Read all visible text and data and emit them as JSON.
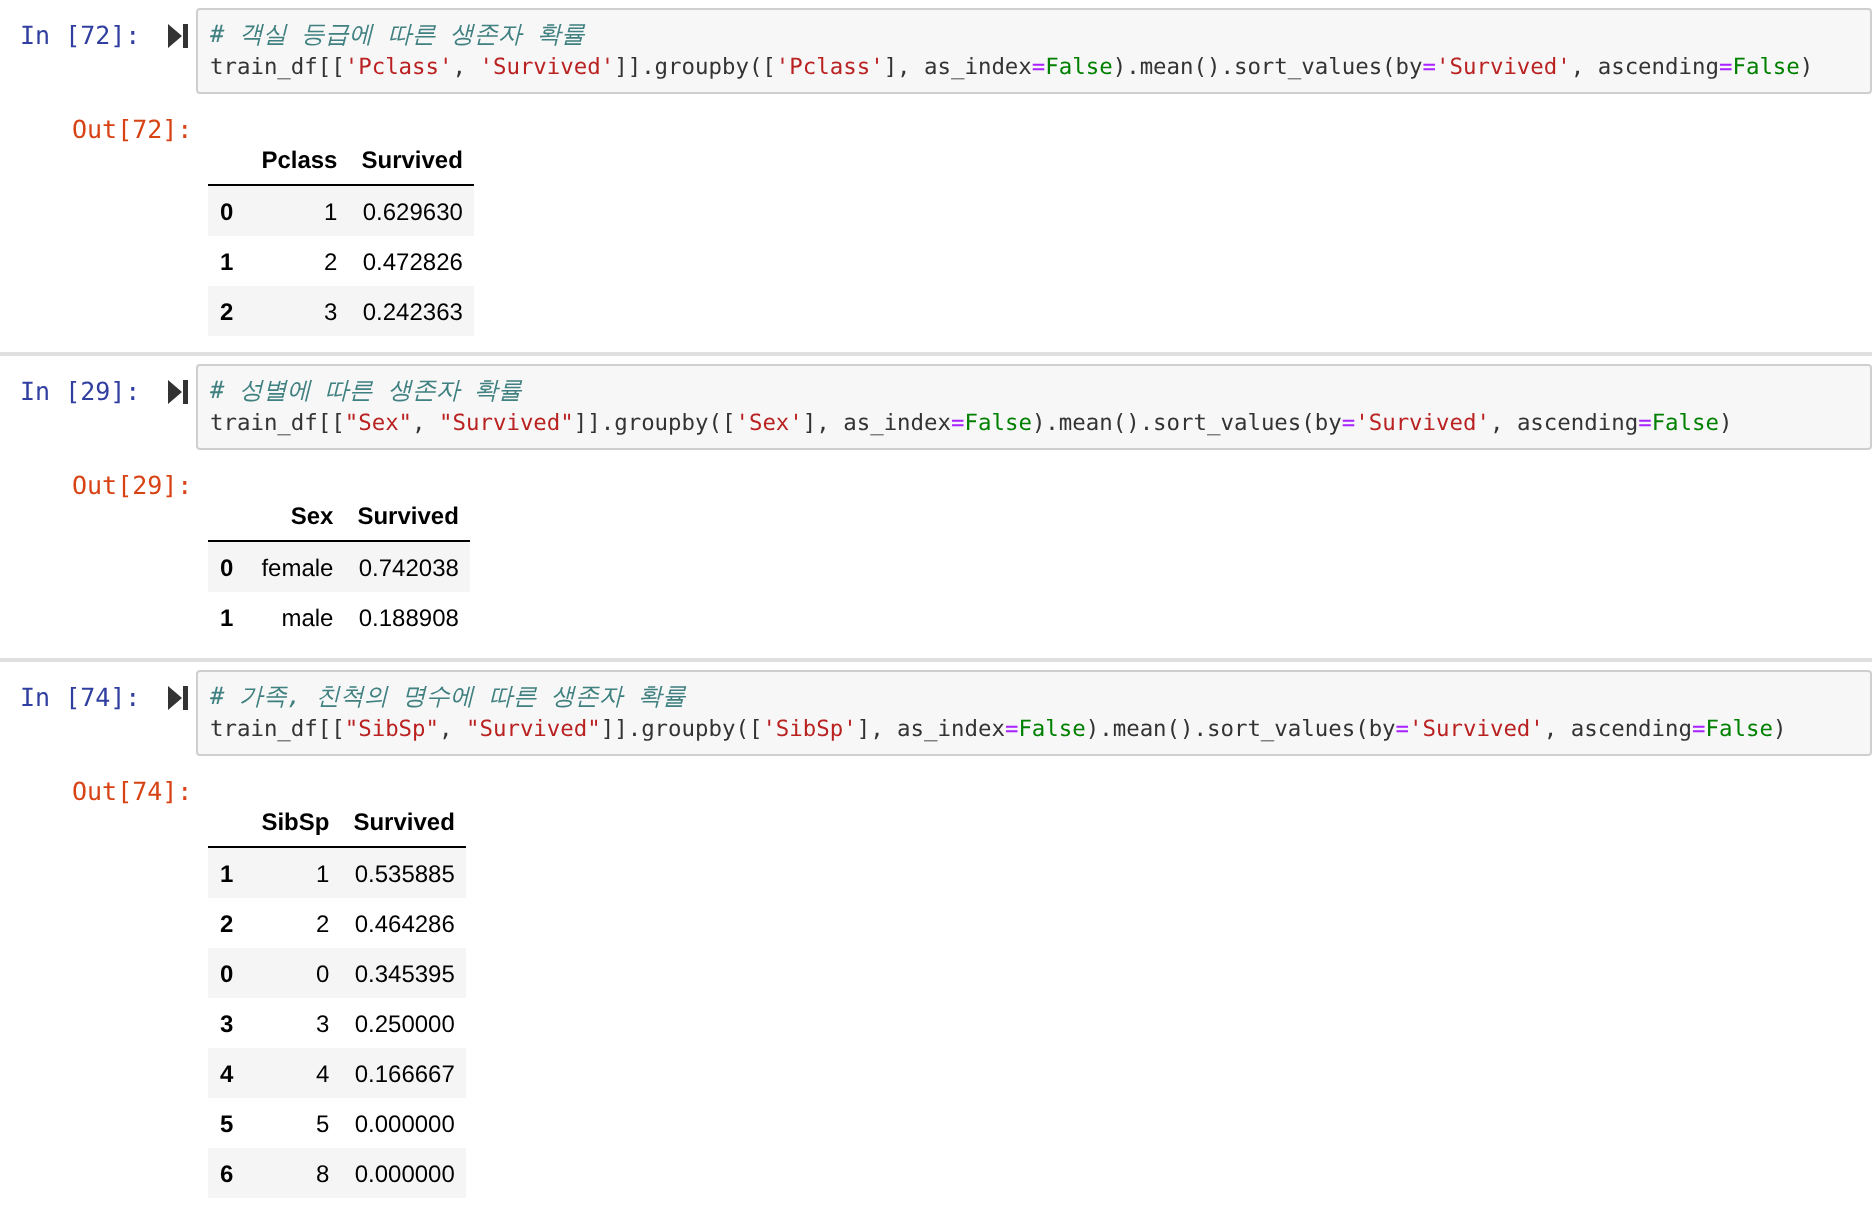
{
  "cells": [
    {
      "prompt_in": "In [72]:",
      "comment": "# 객실 등급에 따른 생존자 확률",
      "code": [
        {
          "kind": "plain",
          "text": "train_df[["
        },
        {
          "kind": "string",
          "text": "'Pclass'"
        },
        {
          "kind": "plain",
          "text": ", "
        },
        {
          "kind": "string",
          "text": "'Survived'"
        },
        {
          "kind": "plain",
          "text": "]].groupby(["
        },
        {
          "kind": "string",
          "text": "'Pclass'"
        },
        {
          "kind": "plain",
          "text": "], as_index"
        },
        {
          "kind": "operator",
          "text": "="
        },
        {
          "kind": "keyword",
          "text": "False"
        },
        {
          "kind": "plain",
          "text": ").mean().sort_values(by"
        },
        {
          "kind": "operator",
          "text": "="
        },
        {
          "kind": "string",
          "text": "'Survived'"
        },
        {
          "kind": "plain",
          "text": ", ascending"
        },
        {
          "kind": "operator",
          "text": "="
        },
        {
          "kind": "keyword",
          "text": "False"
        },
        {
          "kind": "plain",
          "text": ")"
        }
      ],
      "prompt_out": "Out[72]:",
      "table": {
        "columns": [
          "Pclass",
          "Survived"
        ],
        "rows": [
          {
            "index": "0",
            "cells": [
              "1",
              "0.629630"
            ]
          },
          {
            "index": "1",
            "cells": [
              "2",
              "0.472826"
            ]
          },
          {
            "index": "2",
            "cells": [
              "3",
              "0.242363"
            ]
          }
        ]
      }
    },
    {
      "prompt_in": "In [29]:",
      "comment": "# 성별에 따른 생존자 확률",
      "code": [
        {
          "kind": "plain",
          "text": "train_df[["
        },
        {
          "kind": "string",
          "text": "\"Sex\""
        },
        {
          "kind": "plain",
          "text": ", "
        },
        {
          "kind": "string",
          "text": "\"Survived\""
        },
        {
          "kind": "plain",
          "text": "]].groupby(["
        },
        {
          "kind": "string",
          "text": "'Sex'"
        },
        {
          "kind": "plain",
          "text": "], as_index"
        },
        {
          "kind": "operator",
          "text": "="
        },
        {
          "kind": "keyword",
          "text": "False"
        },
        {
          "kind": "plain",
          "text": ").mean().sort_values(by"
        },
        {
          "kind": "operator",
          "text": "="
        },
        {
          "kind": "string",
          "text": "'Survived'"
        },
        {
          "kind": "plain",
          "text": ", ascending"
        },
        {
          "kind": "operator",
          "text": "="
        },
        {
          "kind": "keyword",
          "text": "False"
        },
        {
          "kind": "plain",
          "text": ")"
        }
      ],
      "prompt_out": "Out[29]:",
      "table": {
        "columns": [
          "Sex",
          "Survived"
        ],
        "rows": [
          {
            "index": "0",
            "cells": [
              "female",
              "0.742038"
            ]
          },
          {
            "index": "1",
            "cells": [
              "male",
              "0.188908"
            ]
          }
        ]
      }
    },
    {
      "prompt_in": "In [74]:",
      "comment": "# 가족, 친척의 명수에 따른 생존자 확률",
      "code": [
        {
          "kind": "plain",
          "text": "train_df[["
        },
        {
          "kind": "string",
          "text": "\"SibSp\""
        },
        {
          "kind": "plain",
          "text": ", "
        },
        {
          "kind": "string",
          "text": "\"Survived\""
        },
        {
          "kind": "plain",
          "text": "]].groupby(["
        },
        {
          "kind": "string",
          "text": "'SibSp'"
        },
        {
          "kind": "plain",
          "text": "], as_index"
        },
        {
          "kind": "operator",
          "text": "="
        },
        {
          "kind": "keyword",
          "text": "False"
        },
        {
          "kind": "plain",
          "text": ").mean().sort_values(by"
        },
        {
          "kind": "operator",
          "text": "="
        },
        {
          "kind": "string",
          "text": "'Survived'"
        },
        {
          "kind": "plain",
          "text": ", ascending"
        },
        {
          "kind": "operator",
          "text": "="
        },
        {
          "kind": "keyword",
          "text": "False"
        },
        {
          "kind": "plain",
          "text": ")"
        }
      ],
      "prompt_out": "Out[74]:",
      "table": {
        "columns": [
          "SibSp",
          "Survived"
        ],
        "rows": [
          {
            "index": "1",
            "cells": [
              "1",
              "0.535885"
            ]
          },
          {
            "index": "2",
            "cells": [
              "2",
              "0.464286"
            ]
          },
          {
            "index": "0",
            "cells": [
              "0",
              "0.345395"
            ]
          },
          {
            "index": "3",
            "cells": [
              "3",
              "0.250000"
            ]
          },
          {
            "index": "4",
            "cells": [
              "4",
              "0.166667"
            ]
          },
          {
            "index": "5",
            "cells": [
              "5",
              "0.000000"
            ]
          },
          {
            "index": "6",
            "cells": [
              "8",
              "0.000000"
            ]
          }
        ]
      }
    }
  ]
}
